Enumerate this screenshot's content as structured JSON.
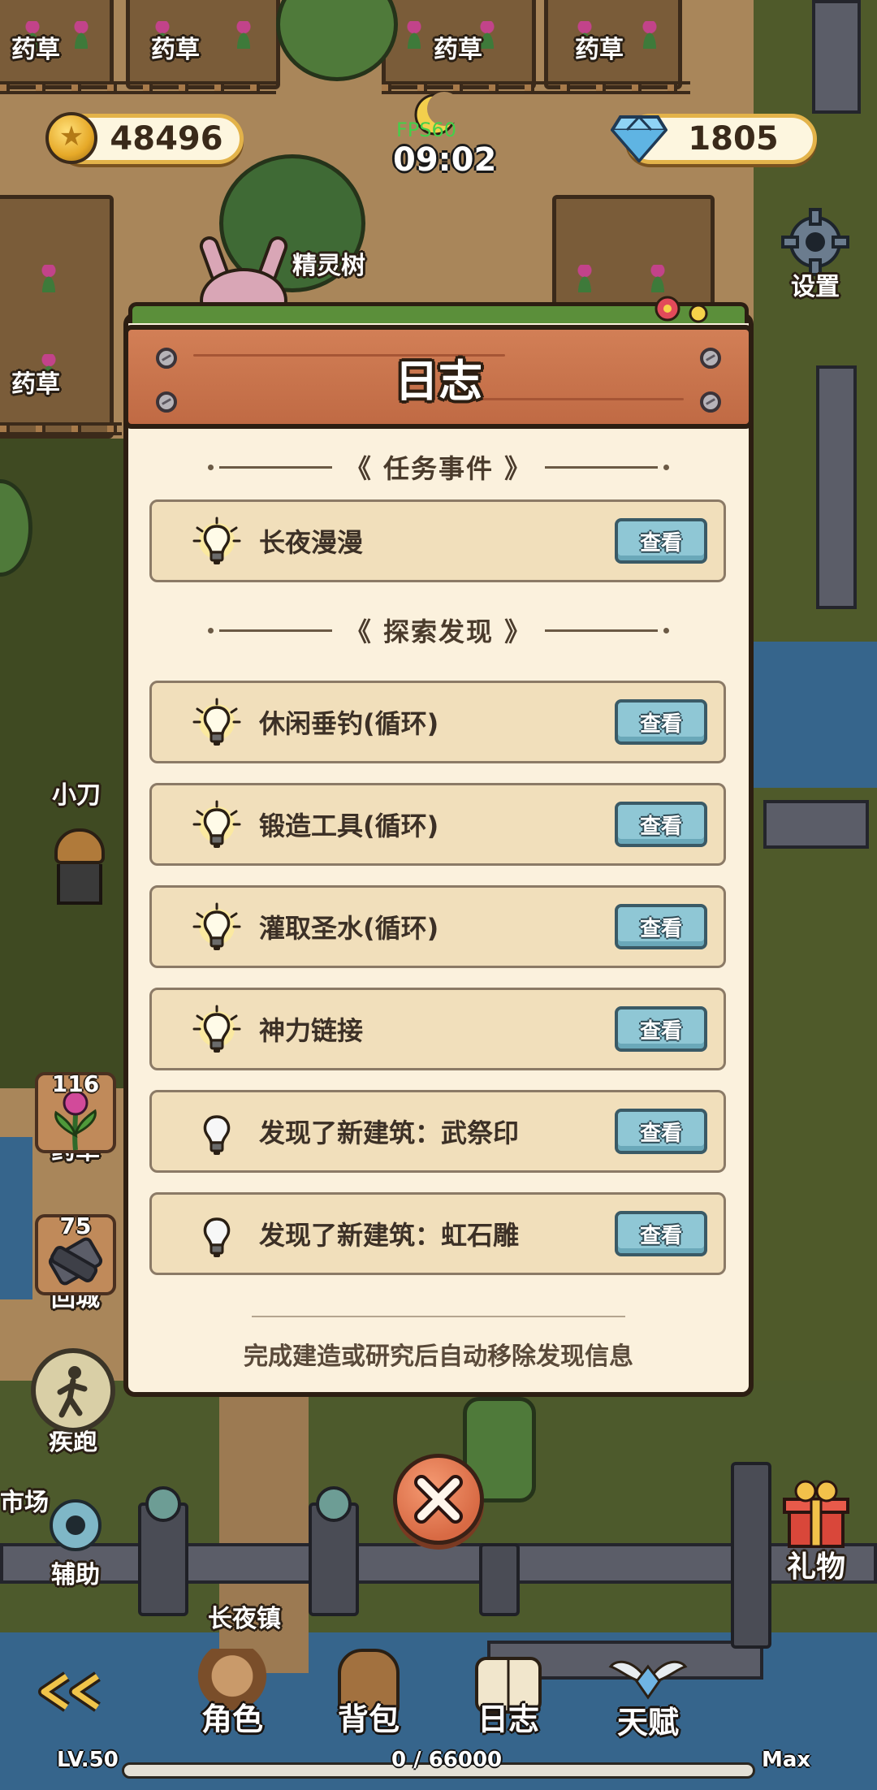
{
  "hud": {
    "gold": "48496",
    "gems": "1805",
    "time": "09:02",
    "fps": "FPS60",
    "settings_label": "设置"
  },
  "map_labels": {
    "herb1": "药草",
    "herb2": "药草",
    "herb3": "药草",
    "herb4": "药草",
    "herb5": "药草",
    "spirit_tree": "精灵树",
    "knife": "小刀",
    "market": "市场",
    "town": "长夜镇"
  },
  "side_buttons": {
    "herb_count": "116",
    "herb_label": "药草",
    "return_count": "75",
    "return_label": "回城",
    "sprint_label": "疾跑",
    "assist_label": "辅助",
    "gift_label": "礼物"
  },
  "dialog": {
    "title": "日志",
    "section_tasks": "《 任务事件 》",
    "section_explore": "《 探索发现 》",
    "view_label": "查看",
    "tasks": [
      {
        "label": "长夜漫漫",
        "icon": "lit-bulb-icon"
      }
    ],
    "discoveries": [
      {
        "label": "休闲垂钓(循环)",
        "icon": "lit-bulb-icon"
      },
      {
        "label": "锻造工具(循环)",
        "icon": "lit-bulb-icon"
      },
      {
        "label": "灌取圣水(循环)",
        "icon": "lit-bulb-icon"
      },
      {
        "label": "神力链接",
        "icon": "lit-bulb-icon"
      },
      {
        "label": "发现了新建筑：武祭印",
        "icon": "bulb-icon"
      },
      {
        "label": "发现了新建筑：虹石雕",
        "icon": "bulb-icon"
      }
    ],
    "footer_note": "完成建造或研究后自动移除发现信息"
  },
  "bottom_nav": {
    "character": "角色",
    "backpack": "背包",
    "log": "日志",
    "talent": "天赋"
  },
  "xp": {
    "level": "LV.50",
    "progress": "0 / 66000",
    "max": "Max",
    "fraction": 0
  },
  "colors": {
    "dialog_bg": "#fbf1dd",
    "header_wood": "#c06a44",
    "view_button": "#8fc7d5",
    "entry_bg": "#f1dfbb"
  }
}
